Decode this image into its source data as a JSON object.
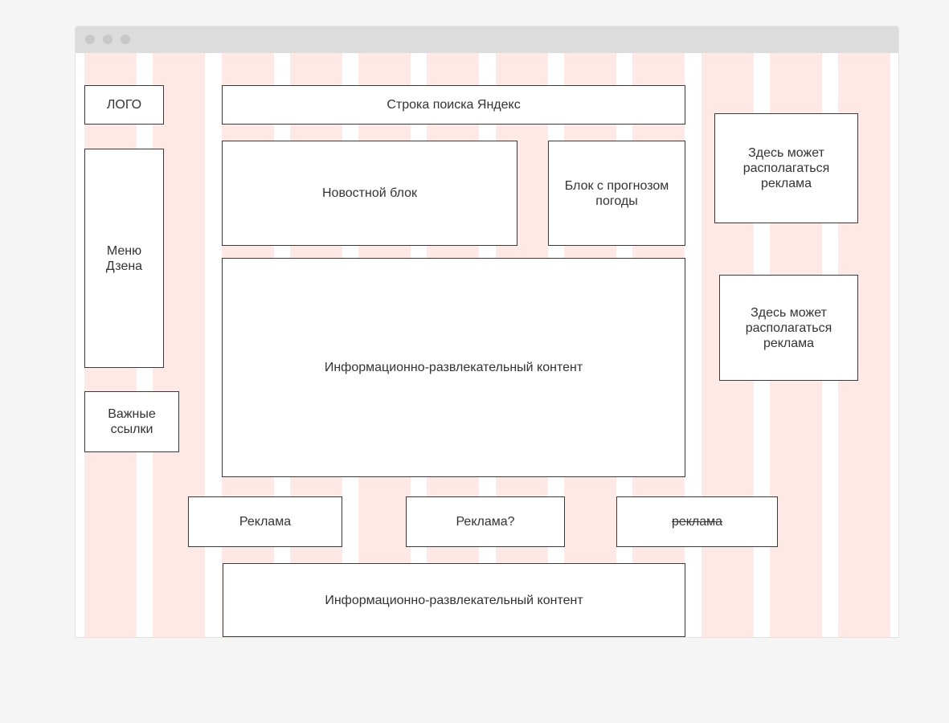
{
  "blocks": {
    "logo": "ЛОГО",
    "search": "Строка поиска Яндекс",
    "zen_menu": "Меню Дзена",
    "news": "Новостной блок",
    "weather": "Блок с прогнозом погоды",
    "ad_top": "Здесь может располагаться реклама",
    "ad_middle": "Здесь может располагаться реклама",
    "content_main": "Информационно-развлекательный контент",
    "important_links": "Важные ссылки",
    "ad_1": "Реклама",
    "ad_2": "Реклама?",
    "ad_3": "реклама",
    "content_bottom": "Информационно-развлекательный контент"
  },
  "colors": {
    "page_background": "#f5f5f5",
    "titlebar": "#dcdcdc",
    "grid_column": "#ffe9e7",
    "block_border": "#3a3a3a"
  }
}
